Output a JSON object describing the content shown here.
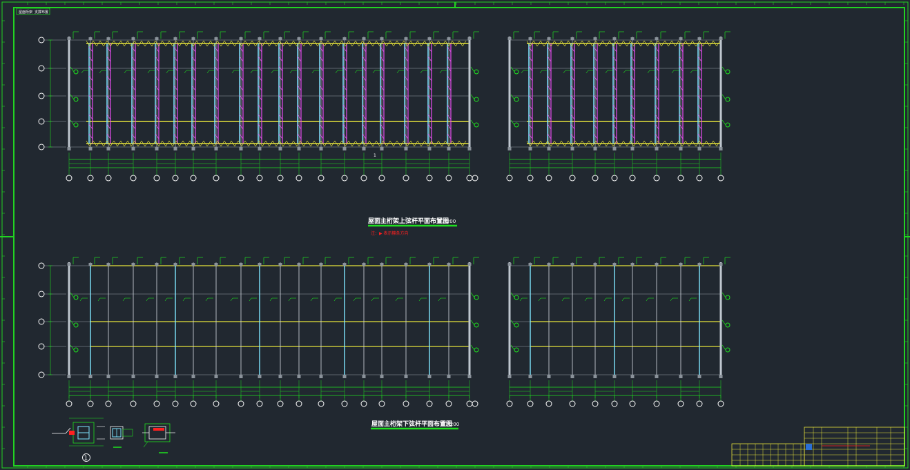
{
  "sheet": {
    "header_tag_1": "屋面桁架",
    "header_tag_2": "支撑布置"
  },
  "plans": {
    "upper": {
      "title": "屋面主桁架上弦杆平面布置图",
      "scale": "1:200",
      "note": "注：▶ 表示檩条方向",
      "center_mark": "1"
    },
    "lower": {
      "title": "屋面主桁架下弦杆平面布置图",
      "scale": "1:200"
    }
  },
  "detail": {
    "marker": "1"
  },
  "colors": {
    "background": "#212830",
    "frame": "#22d322",
    "truss": "#e84ef0",
    "chord": "#e6e33a",
    "column": "#bfc7cf",
    "member": "#7fe6ff",
    "dimension": "#1fe01f",
    "annotation": "#ff2020"
  }
}
